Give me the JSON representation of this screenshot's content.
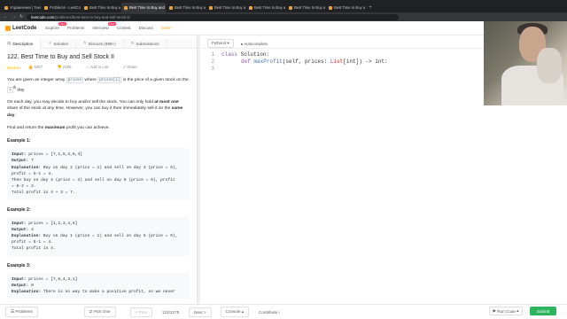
{
  "browser": {
    "tabs": [
      {
        "label": "Упражнения | Тексты",
        "active": false
      },
      {
        "label": "Problems - LeetCode",
        "active": false
      },
      {
        "label": "Best Time to Buy and Sell",
        "active": false
      },
      {
        "label": "Best Time to Buy and Sell",
        "active": true
      },
      {
        "label": "Best Time to Buy and Sell",
        "active": false
      },
      {
        "label": "Best Time to Buy and Sell",
        "active": false
      },
      {
        "label": "Best Time to Buy and Sell",
        "active": false
      },
      {
        "label": "Best Time to Buy and Sell",
        "active": false
      },
      {
        "label": "Best Time to Buy and Sell",
        "active": false
      }
    ],
    "url_host": "leetcode.com",
    "url_path": "/problems/best-time-to-buy-and-sell-stock-ii/"
  },
  "header": {
    "logo": "LeetCode",
    "nav": [
      {
        "label": "Explore",
        "badge": "New"
      },
      {
        "label": "Problems",
        "badge": ""
      },
      {
        "label": "Interview",
        "badge": "New"
      },
      {
        "label": "Contest",
        "badge": ""
      },
      {
        "label": "Discuss",
        "badge": ""
      },
      {
        "label": "Store",
        "badge": ""
      }
    ]
  },
  "subtabs": [
    "Description",
    "Solution",
    "Discuss (999+)",
    "Submissions"
  ],
  "problem": {
    "title": "122. Best Time to Buy and Sell Stock II",
    "difficulty": "Medium",
    "likes": "5357",
    "dislikes": "2185",
    "add_to_list": "Add to List",
    "share": "Share",
    "p1_a": "You are given an integer array ",
    "p1_code1": "prices",
    "p1_b": " where ",
    "p1_code2": "prices[i]",
    "p1_c": " is the price of a given stock on the ",
    "p1_code3": "i",
    "p1_sup": "th",
    "p1_d": " day.",
    "p2_a": "On each day, you may decide to buy and/or sell the stock. You can only hold ",
    "p2_b1": "at most one",
    "p2_b": " share of the stock at any time. However, you can buy it then immediately sell it on the ",
    "p2_b2": "same day",
    "p2_c": ".",
    "p3_a": "Find and return the ",
    "p3_b": "maximum",
    "p3_c": " profit you can achieve.",
    "examples": [
      {
        "label": "Example 1:",
        "lines": [
          {
            "k": "Input:",
            "v": " prices = [7,1,5,3,6,4]"
          },
          {
            "k": "Output:",
            "v": " 7"
          },
          {
            "k": "Explanation:",
            "v": " Buy on day 2 (price = 1) and sell on day 3 (price = 5),"
          },
          {
            "k": "",
            "v": "profit = 5-1 = 4."
          },
          {
            "k": "",
            "v": "Then buy on day 4 (price = 3) and sell on day 5 (price = 6), profit"
          },
          {
            "k": "",
            "v": "= 6-3 = 3."
          },
          {
            "k": "",
            "v": "Total profit is 4 + 3 = 7."
          }
        ]
      },
      {
        "label": "Example 2:",
        "lines": [
          {
            "k": "Input:",
            "v": " prices = [1,2,3,4,5]"
          },
          {
            "k": "Output:",
            "v": " 4"
          },
          {
            "k": "Explanation:",
            "v": " Buy on day 1 (price = 1) and sell on day 5 (price = 5),"
          },
          {
            "k": "",
            "v": "profit = 5-1 = 4."
          },
          {
            "k": "",
            "v": "Total profit is 4."
          }
        ]
      },
      {
        "label": "Example 3:",
        "lines": [
          {
            "k": "Input:",
            "v": " prices = [7,6,4,3,1]"
          },
          {
            "k": "Output:",
            "v": " 0"
          },
          {
            "k": "Explanation:",
            "v": " There is no way to make a positive profit, so we never"
          }
        ]
      }
    ]
  },
  "editor": {
    "language": "Python3",
    "autocomplete": "Autocomplete",
    "line_numbers": [
      "1",
      "2",
      "3"
    ],
    "line1_kw": "class",
    "line1_name": " Solution:",
    "line2_kw": "def",
    "line2_fn": " maxProfit",
    "line2_args": "(self, prices: ",
    "line2_type": "List",
    "line2_rest": "[int]) -> int:"
  },
  "bottom": {
    "problems": "Problems",
    "pick_one": "Pick One",
    "prev": "< Prev",
    "page": "122/2175",
    "next": "Next >",
    "console": "Console",
    "contribute": "Contribute i",
    "run_code": "Run Code",
    "submit": "Submit"
  }
}
